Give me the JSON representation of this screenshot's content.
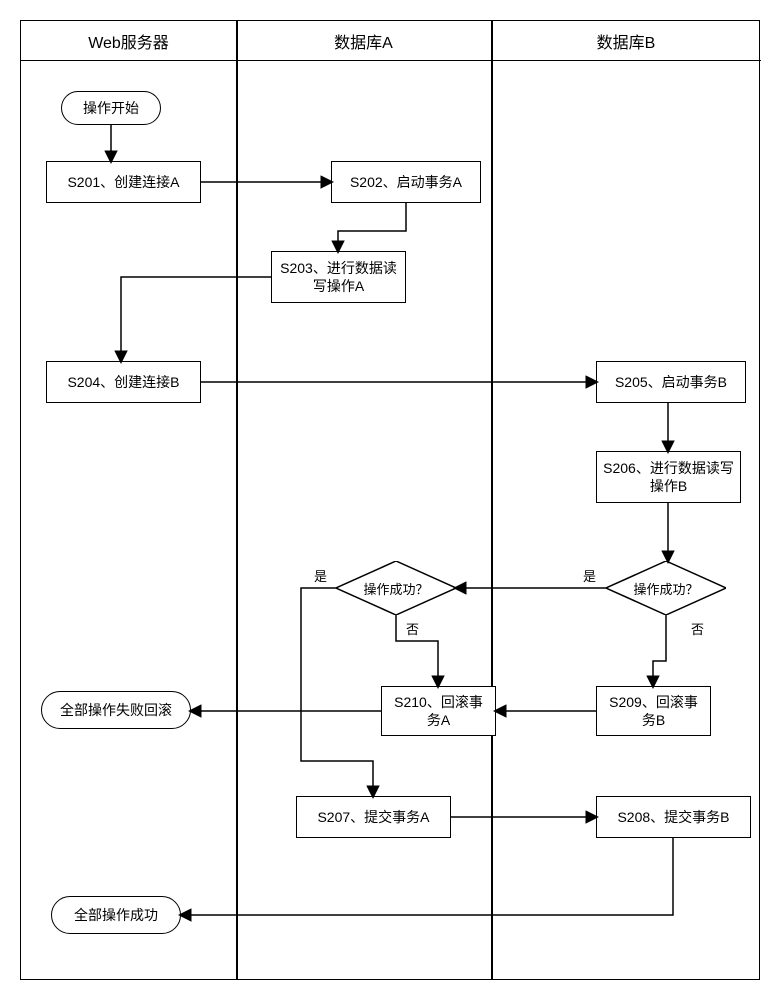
{
  "lanes": {
    "lane1": "Web服务器",
    "lane2": "数据库A",
    "lane3": "数据库B"
  },
  "nodes": {
    "start": "操作开始",
    "s201": "S201、创建连接A",
    "s202": "S202、启动事务A",
    "s203": "S203、进行数据读写操作A",
    "s204": "S204、创建连接B",
    "s205": "S205、启动事务B",
    "s206": "S206、进行数据读写操作B",
    "s207": "S207、提交事务A",
    "s208": "S208、提交事务B",
    "s209": "S209、回滚事务B",
    "s210": "S210、回滚事务A",
    "decisionA": "操作成功？",
    "decisionB": "操作成功？",
    "failEnd": "全部操作失败回滚",
    "successEnd": "全部操作成功"
  },
  "labels": {
    "yes": "是",
    "no": "否"
  }
}
